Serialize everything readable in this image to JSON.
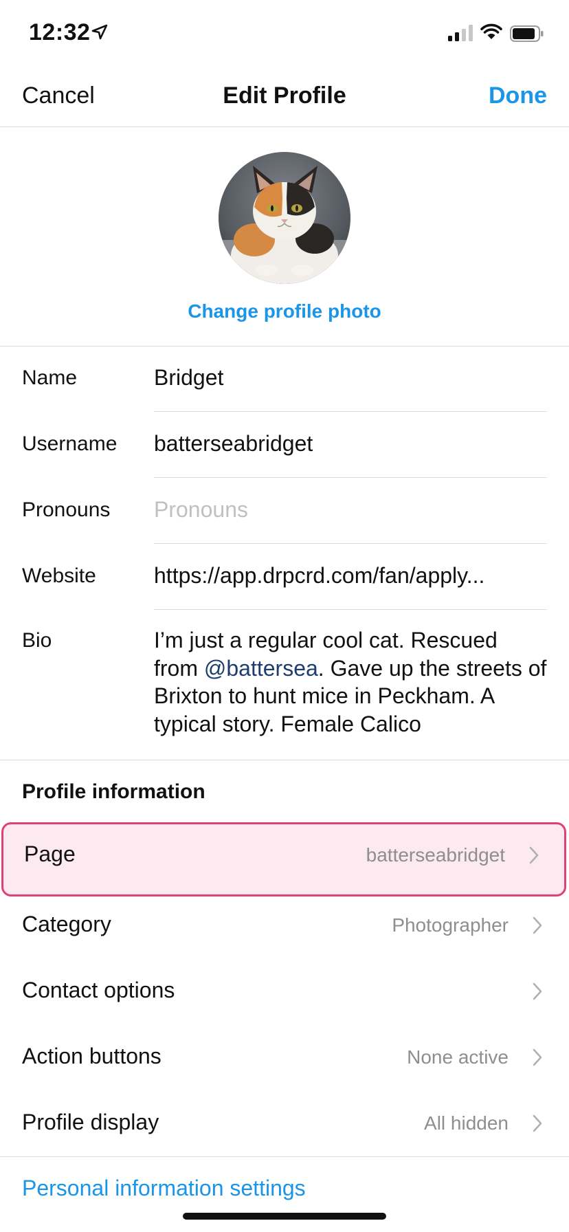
{
  "status_bar": {
    "time": "12:32",
    "icons": [
      "location-arrow-icon",
      "signal-icon",
      "wifi-icon",
      "battery-icon"
    ]
  },
  "nav": {
    "cancel": "Cancel",
    "title": "Edit Profile",
    "done": "Done"
  },
  "profile_photo": {
    "change_label": "Change profile photo"
  },
  "fields": {
    "name": {
      "label": "Name",
      "value": "Bridget"
    },
    "username": {
      "label": "Username",
      "value": "batterseabridget"
    },
    "pronouns": {
      "label": "Pronouns",
      "placeholder": "Pronouns"
    },
    "website": {
      "label": "Website",
      "value": "https://app.drpcrd.com/fan/apply..."
    },
    "bio": {
      "label": "Bio",
      "text_before": "I’m just a regular cool cat. Rescued from ",
      "mention": "@battersea",
      "text_after": ". Gave up the streets of Brixton to hunt mice in Peckham. A typical story. Female Calico"
    }
  },
  "profile_information": {
    "heading": "Profile information",
    "rows": [
      {
        "label": "Page",
        "value": "batterseabridget"
      },
      {
        "label": "Category",
        "value": "Photographer"
      },
      {
        "label": "Contact options",
        "value": ""
      },
      {
        "label": "Action buttons",
        "value": "None active"
      },
      {
        "label": "Profile display",
        "value": "All hidden"
      }
    ]
  },
  "personal_info_link": "Personal information settings",
  "colors": {
    "accent": "#1a95e8",
    "mention": "#1c3e6e",
    "highlight_bg": "#fde9f0",
    "highlight_border": "#e0407a",
    "secondary_text": "#8e8e8e"
  }
}
